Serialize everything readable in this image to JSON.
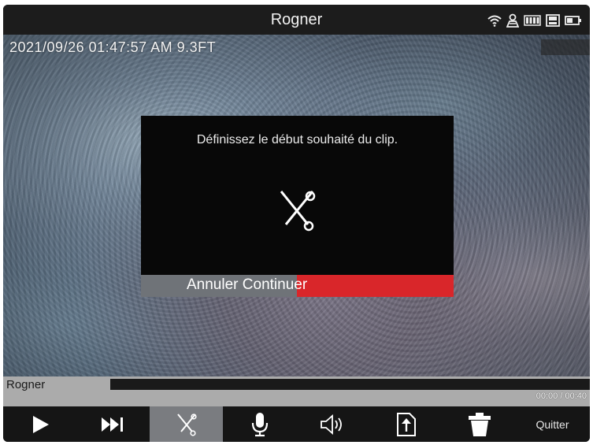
{
  "header": {
    "title": "Rogner"
  },
  "status_icons": [
    "wifi-icon",
    "person-alert-icon",
    "battery-grid-icon",
    "sd-card-icon",
    "battery-icon"
  ],
  "video": {
    "timestamp": "2021/09/26 01:47:57 AM 9.3FT"
  },
  "dialog": {
    "message": "Définissez le début souhaité du clip.",
    "icon": "scissors-icon",
    "cancel_label": "Annuler",
    "continue_label": "Continuer"
  },
  "progress": {
    "label": "Rogner",
    "time": "00:00 / 00:40",
    "fraction": 0
  },
  "toolbar": {
    "items": [
      "play-icon",
      "skip-forward-icon",
      "scissors-icon",
      "microphone-icon",
      "speaker-icon",
      "export-icon",
      "trash-icon"
    ],
    "quit_label": "Quitter"
  },
  "colors": {
    "continue": "#d9262a",
    "cancel": "#6f7378",
    "active_tool": "#7a7c80",
    "progress_bg": "#ababab"
  }
}
